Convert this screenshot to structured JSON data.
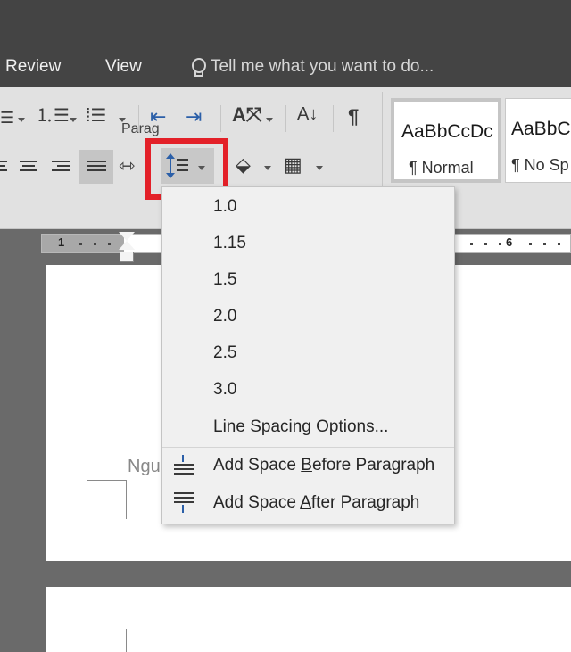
{
  "tabs": [
    {
      "label": "Review"
    },
    {
      "label": "View"
    }
  ],
  "tell_me": {
    "text": "Tell me what you want to do..."
  },
  "ribbon": {
    "paragraph_group_label": "Parag"
  },
  "styles_gallery": [
    {
      "sample": "AaBbCcDc",
      "name": "¶ Normal"
    },
    {
      "sample": "AaBbC",
      "name": "¶ No Sp"
    }
  ],
  "ruler": {
    "numbers": [
      "1",
      "6"
    ]
  },
  "document": {
    "visible_text": "Ngu"
  },
  "line_spacing_menu": {
    "options": [
      {
        "label": "1.0"
      },
      {
        "label": "1.15"
      },
      {
        "label": "1.5"
      },
      {
        "label": "2.0"
      },
      {
        "label": "2.5"
      },
      {
        "label": "3.0"
      }
    ],
    "options_item": {
      "label": "Line Spacing Options..."
    },
    "add_before": {
      "pre": "Add Space ",
      "key": "B",
      "post": "efore Paragraph"
    },
    "add_after": {
      "pre": "Add Space ",
      "key": "A",
      "post": "fter Paragraph"
    }
  },
  "icons": {
    "tell_me": "lightbulb-icon",
    "line_spacing": "line-spacing-icon",
    "sort": "sort-az-icon",
    "show_marks": "pilcrow-icon"
  },
  "colors": {
    "highlight_box": "#e32028",
    "tab_bar": "#444444",
    "ribbon": "#e1e1e1",
    "accent_blue": "#2b5fa8"
  }
}
